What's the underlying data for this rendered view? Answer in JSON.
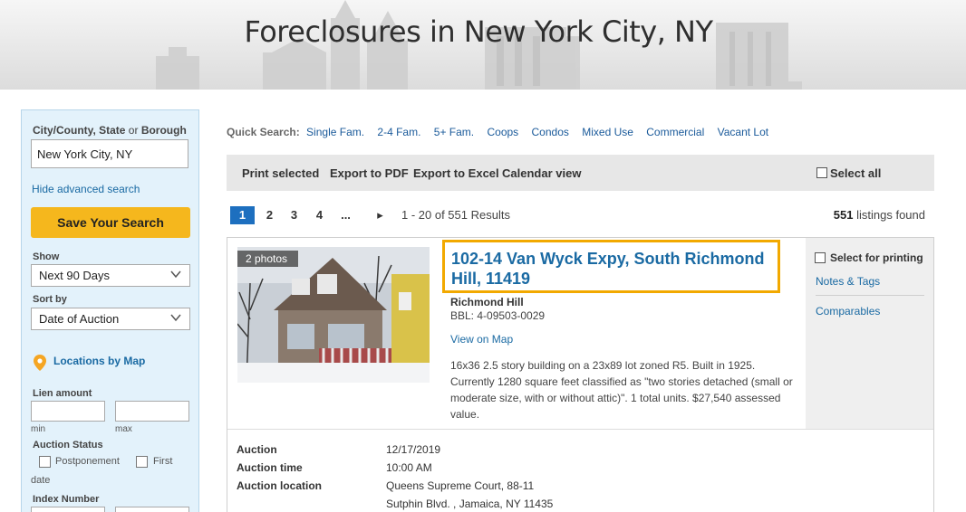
{
  "header": {
    "title": "Foreclosures in New York City, NY"
  },
  "sidebar": {
    "location_label_bold": "City/County, State",
    "location_label_or": "or",
    "location_label_borough": "Borough",
    "location_value": "New York City, NY",
    "hide_advanced": "Hide advanced search",
    "save_search": "Save Your Search",
    "show_label": "Show",
    "show_value": "Next 90 Days",
    "sort_label": "Sort by",
    "sort_value": "Date of Auction",
    "map_link": "Locations by Map",
    "lien_label": "Lien amount",
    "min_label": "min",
    "max_label": "max",
    "auction_status_label": "Auction Status",
    "postponement": "Postponement",
    "first_date_a": "First",
    "first_date_b": "date",
    "index_number_label": "Index Number"
  },
  "quick_search": {
    "label": "Quick Search:",
    "links": [
      "Single Fam.",
      "2-4 Fam.",
      "5+ Fam.",
      "Coops",
      "Condos",
      "Mixed Use",
      "Commercial",
      "Vacant Lot"
    ]
  },
  "toolbar": {
    "print_selected": "Print selected",
    "export_pdf": "Export to PDF",
    "export_excel": "Export to Excel",
    "calendar_view": "Calendar view",
    "select_all": "Select all"
  },
  "pagination": {
    "pages": [
      "1",
      "2",
      "3",
      "4",
      "..."
    ],
    "next": "▸",
    "range": "1 - 20 of 551 Results",
    "count": "551",
    "found_label": "listings found"
  },
  "listing": {
    "photos": "2 photos",
    "title": "102-14 Van Wyck Expy, South Richmond Hill, 11419",
    "neighborhood": "Richmond Hill",
    "bbl": "BBL: 4-09503-0029",
    "view_on_map": "View on Map",
    "description": "16x36 2.5 story building on a 23x89 lot zoned R5. Built in 1925. Currently 1280 square feet classified as \"two stories detached (small or moderate size, with or without attic)\". 1 total units. $27,540 assessed value.",
    "select_printing": "Select for printing",
    "notes_tags": "Notes & Tags",
    "comparables": "Comparables",
    "details": {
      "auction_label": "Auction",
      "auction_value": "12/17/2019",
      "auction_time_label": "Auction time",
      "auction_time_value": "10:00 AM",
      "auction_location_label": "Auction location",
      "auction_location_line1": "Queens Supreme Court, 88-11",
      "auction_location_line2": "Sutphin Blvd. , Jamaica, NY 11435"
    }
  },
  "colors": {
    "accent_yellow": "#f5b71d",
    "link_blue": "#1a6aa3",
    "page_active": "#1d6fbf",
    "highlight_border": "#f2a900"
  }
}
